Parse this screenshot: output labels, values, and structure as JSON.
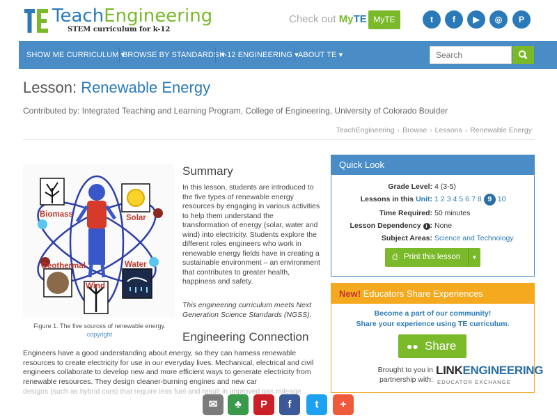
{
  "header": {
    "logo_part1": "Teach",
    "logo_part2": "Engineering",
    "tagline": "STEM curriculum for k-12",
    "checkout_text": "Check out",
    "myte_brand": "My",
    "myte_te": "TE",
    "myte_button": "MyTE",
    "social": [
      {
        "name": "twitter-icon",
        "glyph": "t"
      },
      {
        "name": "facebook-icon",
        "glyph": "f"
      },
      {
        "name": "youtube-icon",
        "glyph": "▶"
      },
      {
        "name": "instagram-icon",
        "glyph": "◎"
      },
      {
        "name": "pinterest-icon",
        "glyph": "P"
      }
    ]
  },
  "nav": {
    "items": [
      "SHOW ME CURRICULUM",
      "BROWSE BY STANDARDS",
      "K-12 ENGINEERING",
      "ABOUT TE"
    ],
    "search_placeholder": "Search"
  },
  "lesson": {
    "prefix": "Lesson:",
    "title": "Renewable Energy",
    "contributed": "Contributed by: Integrated Teaching and Learning Program, College of Engineering, University of Colorado Boulder",
    "breadcrumb": [
      "TeachEngineering",
      "Browse",
      "Lessons",
      "Renewable Energy"
    ]
  },
  "figure": {
    "labels": [
      "Biomass",
      "Solar",
      "Geothermal",
      "Water",
      "Wind"
    ],
    "caption": "Figure 1. The five sources of renewable energy.",
    "copyright": "copyright"
  },
  "summary": {
    "heading": "Summary",
    "text": "In this lesson, students are introduced to the five types of renewable energy resources by engaging in various activities to help them understand the transformation of energy (solar, water and wind) into electricity. Students explore the different roles engineers who work in renewable energy fields have in creating a sustainable environment – an environment that contributes to greater health, happiness and safety.",
    "ngss": "This engineering curriculum meets Next Generation Science Standards (NGSS)."
  },
  "engineering": {
    "heading": "Engineering Connection",
    "text": "Engineers have a good understanding about energy, so they can harness renewable resources to create electricity for use in our everyday lives. Mechanical, electrical and civil engineers collaborate to develop new and more efficient ways to generate electricity from renewable resources. They design cleaner-burning engines and new car",
    "text_faded": "designs (such as hybrid cars) that require less fuel and result in improved gas mileage"
  },
  "quick_look": {
    "title": "Quick Look",
    "grade_label": "Grade Level:",
    "grade_value": "4 (3-5)",
    "lessons_label": "Lessons in this",
    "lessons_unit": "Unit",
    "lessons_colon": ":",
    "lesson_numbers": [
      "1",
      "2",
      "3",
      "4",
      "5",
      "6",
      "7",
      "8",
      "9",
      "10"
    ],
    "current_lesson": "9",
    "time_label": "Time Required:",
    "time_value": "50 minutes",
    "dep_label": "Lesson Dependency",
    "dep_value": "None",
    "subject_label": "Subject Areas:",
    "subject_value": "Science and Technology",
    "print_label": "Print this lesson"
  },
  "educators": {
    "new_label": "New!",
    "title": "Educators Share Experiences",
    "line1": "Become a part of our community!",
    "line2": "Share your experience using TE curriculum.",
    "share_label": "Share",
    "brought": "Brought to you in partnership with:",
    "le_part1": "LINK",
    "le_part2": "ENGINEERING",
    "le_sub": "EDUCATOR EXCHANGE"
  },
  "float_share": [
    {
      "name": "email-share-icon",
      "glyph": "✉",
      "color": "#7b7b7b"
    },
    {
      "name": "classroom-share-icon",
      "glyph": "♣",
      "color": "#3a9a4b"
    },
    {
      "name": "pinterest-share-icon",
      "glyph": "P",
      "color": "#cb2027"
    },
    {
      "name": "facebook-share-icon",
      "glyph": "f",
      "color": "#3b5998"
    },
    {
      "name": "twitter-share-icon",
      "glyph": "t",
      "color": "#1da1f2"
    },
    {
      "name": "more-share-icon",
      "glyph": "+",
      "color": "#f05a3c"
    }
  ],
  "colors": {
    "brand_blue": "#2a7ab9",
    "brand_green": "#7ab929",
    "nav_blue": "#4a8cc6",
    "accent_orange": "#f4a91e"
  }
}
